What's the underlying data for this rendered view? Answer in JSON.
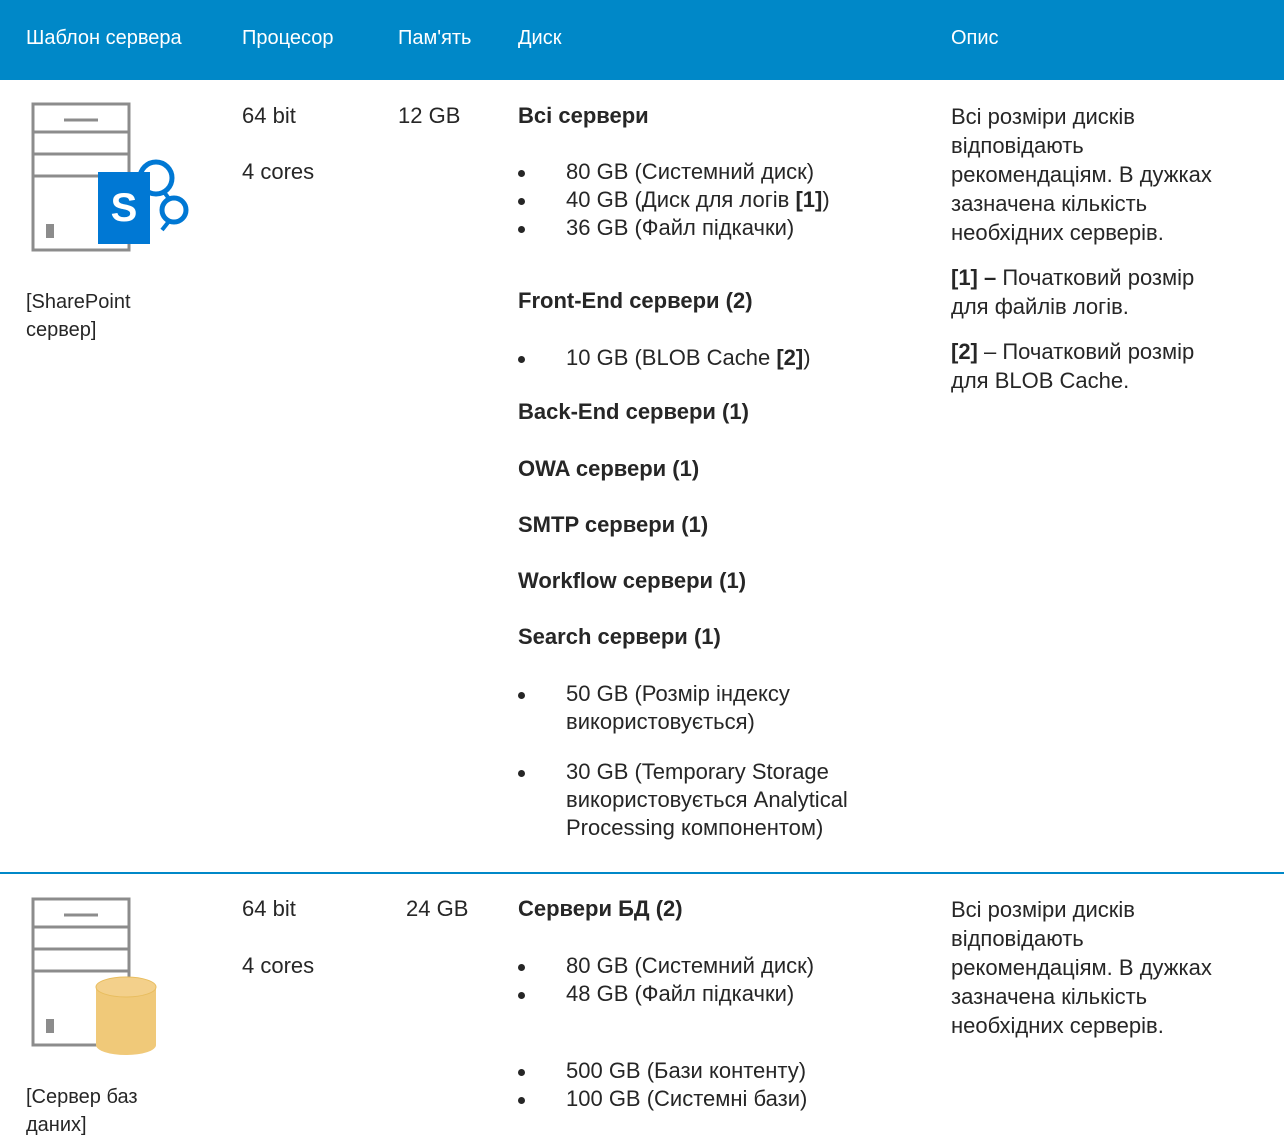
{
  "header": {
    "col_template": "Шаблон сервера",
    "col_cpu": "Процесор",
    "col_memory": "Пам'ять",
    "col_disk": "Диск",
    "col_desc": "Опис"
  },
  "rows": [
    {
      "caption_line1": "[SharePoint",
      "caption_line2": "сервер]",
      "cpu_bits": "64 bit",
      "cpu_cores": "4 cores",
      "memory": "12 GB",
      "disk": {
        "all_title": "Всі сервери",
        "all_items": [
          "80 GB (Системний диск)",
          "40 GB (Диск для логів ",
          "36 GB (Файл підкачки)"
        ],
        "all_item2_ref": "[1]",
        "all_item2_end": ")",
        "frontend_title": "Front-End сервери (2)",
        "frontend_item": "10 GB (BLOB Cache ",
        "frontend_item_ref": "[2]",
        "frontend_item_end": ")",
        "backend_title": "Back-End сервери (1)",
        "owa_title": "OWA сервери (1)",
        "smtp_title": "SMTP сервери (1)",
        "workflow_title": "Workflow сервери (1)",
        "search_title": "Search сервери (1)",
        "search_item1_l1": "50 GB (Розмір індексу",
        "search_item1_l2": "використовується)",
        "search_item2_l1": "30 GB (Temporary Storage",
        "search_item2_l2": "використовується Analytical",
        "search_item2_l3": "Processing компонентом)"
      },
      "desc": {
        "p1_l1": "Всі розміри дисків",
        "p1_l2": "відповідають",
        "p1_l3": "рекомендаціям. В дужках",
        "p1_l4": "зазначена кількість",
        "p1_l5": "необхідних серверів.",
        "p2_ref": "[1] –",
        "p2_l1": " Початковий розмір",
        "p2_l2": "для файлів логів.",
        "p3_ref": "[2]",
        "p3_l1": " – Початковий розмір",
        "p3_l2": "для BLOB Cache."
      }
    },
    {
      "caption_line1": "[Сервер баз",
      "caption_line2": "даних]",
      "cpu_bits": "64 bit",
      "cpu_cores": "4 cores",
      "memory": "24 GB",
      "disk": {
        "title": "Сервери БД (2)",
        "items": [
          "80 GB (Системний диск)",
          "48 GB (Файл підкачки)",
          "500 GB (Бази контенту)",
          "100 GB (Системні бази)"
        ]
      },
      "desc": {
        "l1": "Всі розміри дисків",
        "l2": "відповідають",
        "l3": "рекомендаціям. В дужках",
        "l4": "зазначена кількість",
        "l5": "необхідних серверів."
      }
    }
  ],
  "colors": {
    "header_bg": "#0088c8",
    "sharepoint_blue": "#0078d4",
    "db_gold": "#f0c979"
  },
  "icons": [
    "sharepoint-server-icon",
    "database-server-icon"
  ]
}
